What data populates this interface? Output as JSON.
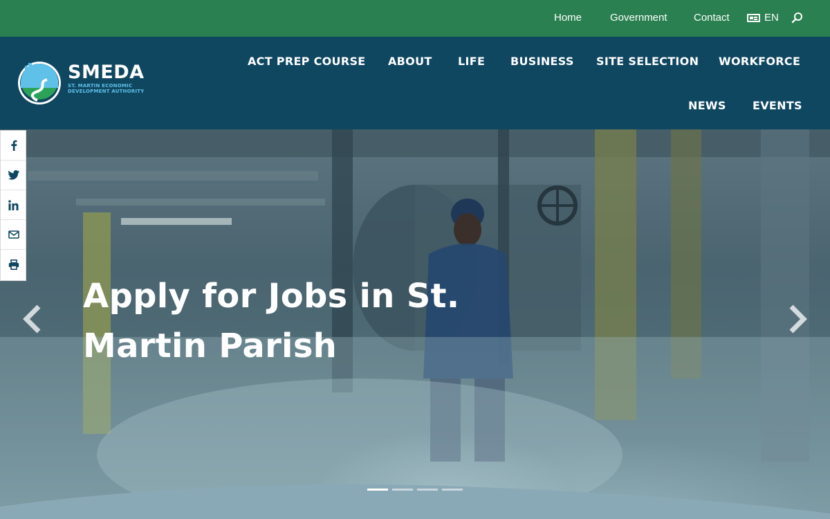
{
  "topbar": {
    "links": [
      {
        "label": "Home"
      },
      {
        "label": "Government"
      },
      {
        "label": "Contact"
      }
    ],
    "language": "EN"
  },
  "brand": {
    "name": "SMEDA",
    "subtitle_line1": "ST. MARTIN ECONOMIC",
    "subtitle_line2": "DEVELOPMENT AUTHORITY"
  },
  "nav": {
    "items": [
      {
        "label": "ACT PREP COURSE"
      },
      {
        "label": "ABOUT"
      },
      {
        "label": "LIFE"
      },
      {
        "label": "BUSINESS"
      },
      {
        "label": "SITE SELECTION"
      },
      {
        "label": "WORKFORCE"
      },
      {
        "label": "NEWS"
      },
      {
        "label": "EVENTS"
      }
    ]
  },
  "hero": {
    "title": "Apply for Jobs in St. Martin Parish",
    "slide_count": 4,
    "active_slide": 1
  },
  "social": {
    "icons": [
      "facebook-icon",
      "twitter-icon",
      "linkedin-icon",
      "email-icon",
      "print-icon"
    ]
  },
  "colors": {
    "topbar": "#2a8050",
    "header": "#0f4761",
    "accent_light_blue": "#5fc0e8",
    "wave": "#8aa9b6"
  }
}
